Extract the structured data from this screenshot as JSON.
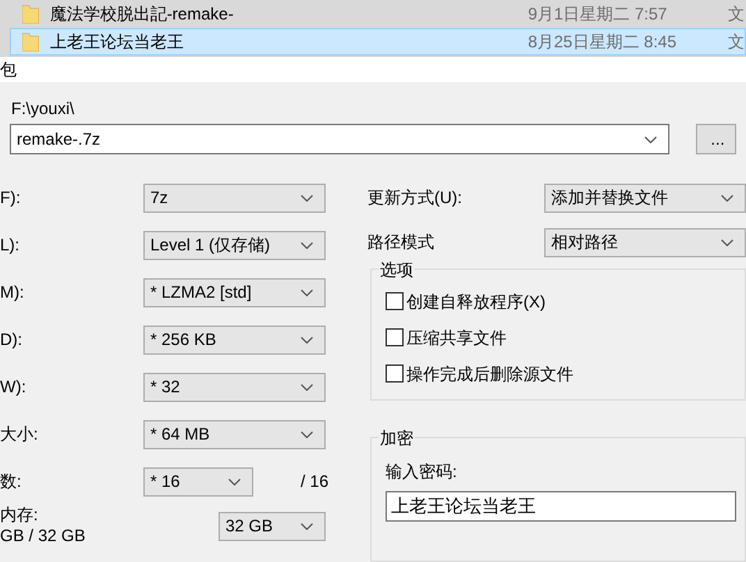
{
  "file_list": [
    {
      "name": "魔法学校脱出記-remake-",
      "date": "9月1日星期二 7:57",
      "type": "文",
      "selected": false
    },
    {
      "name": "上老王论坛当老王",
      "date": "8月25日星期二 8:45",
      "type": "文",
      "selected": true
    }
  ],
  "dialog": {
    "title": "包",
    "archive": {
      "folder": "F:\\youxi\\",
      "name": "remake-.7z",
      "browse": "..."
    },
    "settings": [
      {
        "label": "F):",
        "value": "7z"
      },
      {
        "label": "L):",
        "value": "Level 1 (仅存储)"
      },
      {
        "label": "M):",
        "value": "* LZMA2 [std]"
      },
      {
        "label": "D):",
        "value": "* 256 KB"
      },
      {
        "label": "W):",
        "value": "* 32"
      },
      {
        "label": "大小:",
        "value": "* 64 MB"
      }
    ],
    "threads": {
      "label": "数:",
      "value": "* 16",
      "max": "/ 16"
    },
    "memory": {
      "label": "内存:",
      "usage": "GB / 32 GB",
      "value": "32 GB"
    },
    "update_mode": {
      "label": "更新方式(U):",
      "value": "添加并替换文件"
    },
    "path_mode": {
      "label": "路径模式",
      "value": "相对路径"
    },
    "options": {
      "title": "选项",
      "items": [
        {
          "label": "创建自释放程序(X)",
          "checked": false
        },
        {
          "label": "压缩共享文件",
          "checked": false
        },
        {
          "label": "操作完成后删除源文件",
          "checked": false
        }
      ]
    },
    "encryption": {
      "title": "加密",
      "password_label": "输入密码:",
      "password": "上老王论坛当老王"
    }
  }
}
